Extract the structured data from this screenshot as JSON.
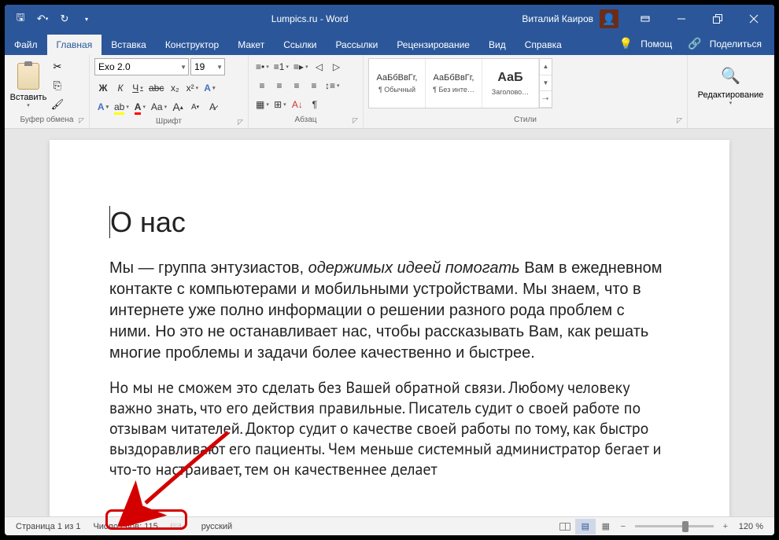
{
  "titlebar": {
    "title": "Lumpics.ru - Word",
    "user": "Виталий Каиров"
  },
  "tabs": {
    "file": "Файл",
    "items": [
      "Главная",
      "Вставка",
      "Конструктор",
      "Макет",
      "Ссылки",
      "Рассылки",
      "Рецензирование",
      "Вид",
      "Справка"
    ],
    "active_index": 0,
    "help": "Помощ",
    "share": "Поделиться"
  },
  "ribbon": {
    "clipboard": {
      "paste": "Вставить",
      "label": "Буфер обмена"
    },
    "font": {
      "name": "Exo 2.0",
      "size": "19",
      "bold": "Ж",
      "italic": "К",
      "underline": "Ч",
      "strike": "abc",
      "sub": "x₂",
      "sup": "x",
      "effects": "A",
      "highlight": "ab",
      "color": "A",
      "case": "Aa",
      "grow": "A",
      "shrink": "A",
      "clear": "A",
      "label": "Шрифт"
    },
    "paragraph": {
      "label": "Абзац"
    },
    "styles": {
      "items": [
        {
          "preview": "АаБбВвГг,",
          "name": "¶ Обычный"
        },
        {
          "preview": "АаБбВвГг,",
          "name": "¶ Без инте…"
        },
        {
          "preview": "АаБ",
          "name": "Заголово…"
        }
      ],
      "label": "Стили"
    },
    "editing": {
      "label": "Редактирование"
    }
  },
  "document": {
    "heading": "О нас",
    "p1_a": "Мы — группа энтузиастов, ",
    "p1_em": "одержимых идеей помогать",
    "p1_b": " Вам в ежедневном контакте с компьютерами и мобильными устройствами. Мы знаем, что в интернете уже полно информации о решении разного рода проблем с ними. Но это не останавливает нас, чтобы рассказывать Вам, как решать многие проблемы и задачи более качественно и быстрее.",
    "p2": "Но мы не сможем это сделать без Вашей обратной связи. Любому человеку важно знать, что его действия правильные. Писатель судит о своей работе по отзывам читателей. Доктор судит о качестве своей работы по тому, как быстро выздоравливают его пациенты. Чем меньше системный администратор бегает и что-то настраивает, тем он качественнее делает"
  },
  "statusbar": {
    "page": "Страница 1 из 1",
    "words": "Число слов: 115",
    "language": "русский",
    "zoom": "120 %"
  }
}
